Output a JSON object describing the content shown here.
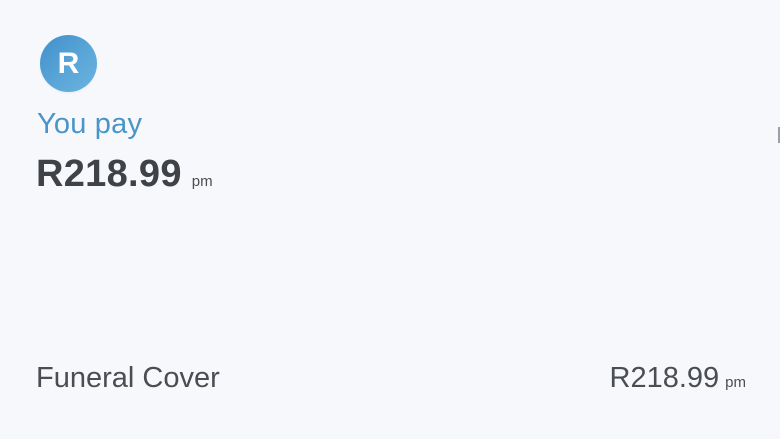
{
  "header": {
    "avatar_letter": "R",
    "you_pay_label": "You pay",
    "total_amount": "R218.99",
    "total_unit": "pm"
  },
  "items": [
    {
      "label": "Funeral Cover",
      "amount": "R218.99",
      "unit": "pm"
    }
  ],
  "colors": {
    "accent": "#4a95c8",
    "avatar_bg": "#4a9bd1",
    "text_dark": "#3f4247",
    "background": "#f7f8fb"
  }
}
